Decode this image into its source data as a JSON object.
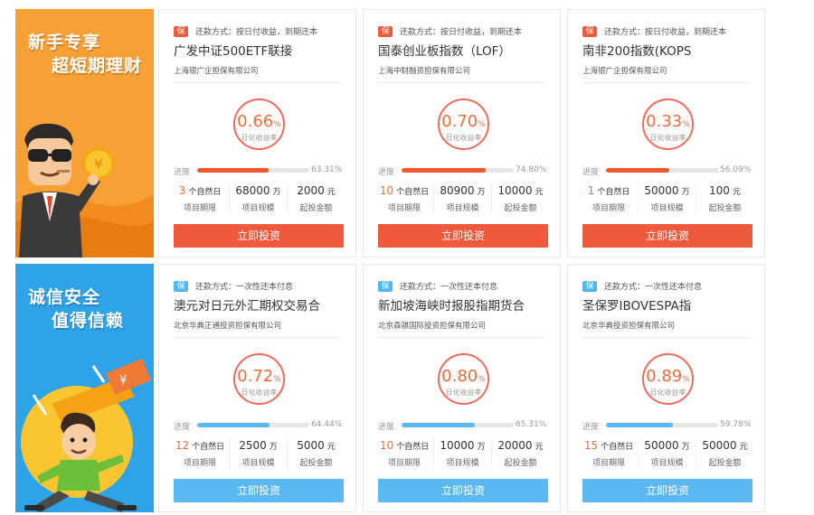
{
  "rows": [
    {
      "banner": {
        "line1": "新手专享",
        "line2": "超短期理财",
        "theme": "orange"
      },
      "cards": [
        {
          "badge": "保",
          "repay": "还款方式：按日付收益，到期还本",
          "name": "广发中证500ETF联接",
          "guarantor": "上海银广企担保有限公司",
          "rate": "0.66",
          "rate_unit": "%",
          "rate_label": "日化收益率",
          "progress_label": "进度",
          "progress": 63.31,
          "progress_text": "63.31%",
          "term_value": "3",
          "term_unit": "个自然日",
          "term_label": "项目期限",
          "scale_value": "68000",
          "scale_unit": "万",
          "scale_label": "项目规模",
          "min_value": "2000",
          "min_unit": "元",
          "min_label": "起投金额",
          "button": "立即投资"
        },
        {
          "badge": "保",
          "repay": "还款方式：按日付收益，到期还本",
          "name": "国泰创业板指数（LOF）",
          "guarantor": "上海中财融资担保有限公司",
          "rate": "0.70",
          "rate_unit": "%",
          "rate_label": "日化收益率",
          "progress_label": "进度",
          "progress": 74.8,
          "progress_text": "74.80%",
          "term_value": "10",
          "term_unit": "个自然日",
          "term_label": "项目期限",
          "scale_value": "80900",
          "scale_unit": "万",
          "scale_label": "项目规模",
          "min_value": "10000",
          "min_unit": "元",
          "min_label": "起投金额",
          "button": "立即投资"
        },
        {
          "badge": "保",
          "repay": "还款方式：按日付收益，到期还本",
          "name": "南非200指数(KOPS",
          "guarantor": "上海银广企担保有限公司",
          "rate": "0.33",
          "rate_unit": "%",
          "rate_label": "日化收益率",
          "progress_label": "进度",
          "progress": 56.09,
          "progress_text": "56.09%",
          "term_value": "1",
          "term_unit": "个自然日",
          "term_label": "项目期限",
          "scale_value": "50000",
          "scale_unit": "万",
          "scale_label": "项目规模",
          "min_value": "100",
          "min_unit": "元",
          "min_label": "起投金额",
          "button": "立即投资"
        }
      ]
    },
    {
      "banner": {
        "line1": "诚信安全",
        "line2": "值得信赖",
        "theme": "blue"
      },
      "cards": [
        {
          "badge": "保",
          "repay": "还款方式：一次性还本付息",
          "name": "澳元对日元外汇期权交易合",
          "guarantor": "北京华典正通投资担保有限公司",
          "rate": "0.72",
          "rate_unit": "%",
          "rate_label": "日化收益率",
          "progress_label": "进度",
          "progress": 64.44,
          "progress_text": "64.44%",
          "term_value": "12",
          "term_unit": "个自然日",
          "term_label": "项目期限",
          "scale_value": "2500",
          "scale_unit": "万",
          "scale_label": "项目规模",
          "min_value": "5000",
          "min_unit": "元",
          "min_label": "起投金额",
          "button": "立即投资"
        },
        {
          "badge": "保",
          "repay": "还款方式：一次性还本付息",
          "name": "新加坡海峡时报股指期货合",
          "guarantor": "北京森骐国际投资担保有限公司",
          "rate": "0.80",
          "rate_unit": "%",
          "rate_label": "日化收益率",
          "progress_label": "进度",
          "progress": 65.31,
          "progress_text": "65.31%",
          "term_value": "10",
          "term_unit": "个自然日",
          "term_label": "项目期限",
          "scale_value": "10000",
          "scale_unit": "万",
          "scale_label": "项目规模",
          "min_value": "20000",
          "min_unit": "元",
          "min_label": "起投金额",
          "button": "立即投资"
        },
        {
          "badge": "保",
          "repay": "还款方式：一次性还本付息",
          "name": "圣保罗IBOVESPA指",
          "guarantor": "北京华典投资担保有限公司",
          "rate": "0.89",
          "rate_unit": "%",
          "rate_label": "日化收益率",
          "progress_label": "进度",
          "progress": 59.78,
          "progress_text": "59.78%",
          "term_value": "15",
          "term_unit": "个自然日",
          "term_label": "项目期限",
          "scale_value": "50000",
          "scale_unit": "万",
          "scale_label": "项目规模",
          "min_value": "50000",
          "min_unit": "元",
          "min_label": "起投金额",
          "button": "立即投资"
        }
      ]
    }
  ],
  "colors": {
    "accent_red": "#f05a3c",
    "accent_blue": "#5bb8f0",
    "banner_orange": "#f7a035",
    "banner_blue": "#2ea3e8",
    "rate_text": "#f06b3a"
  }
}
